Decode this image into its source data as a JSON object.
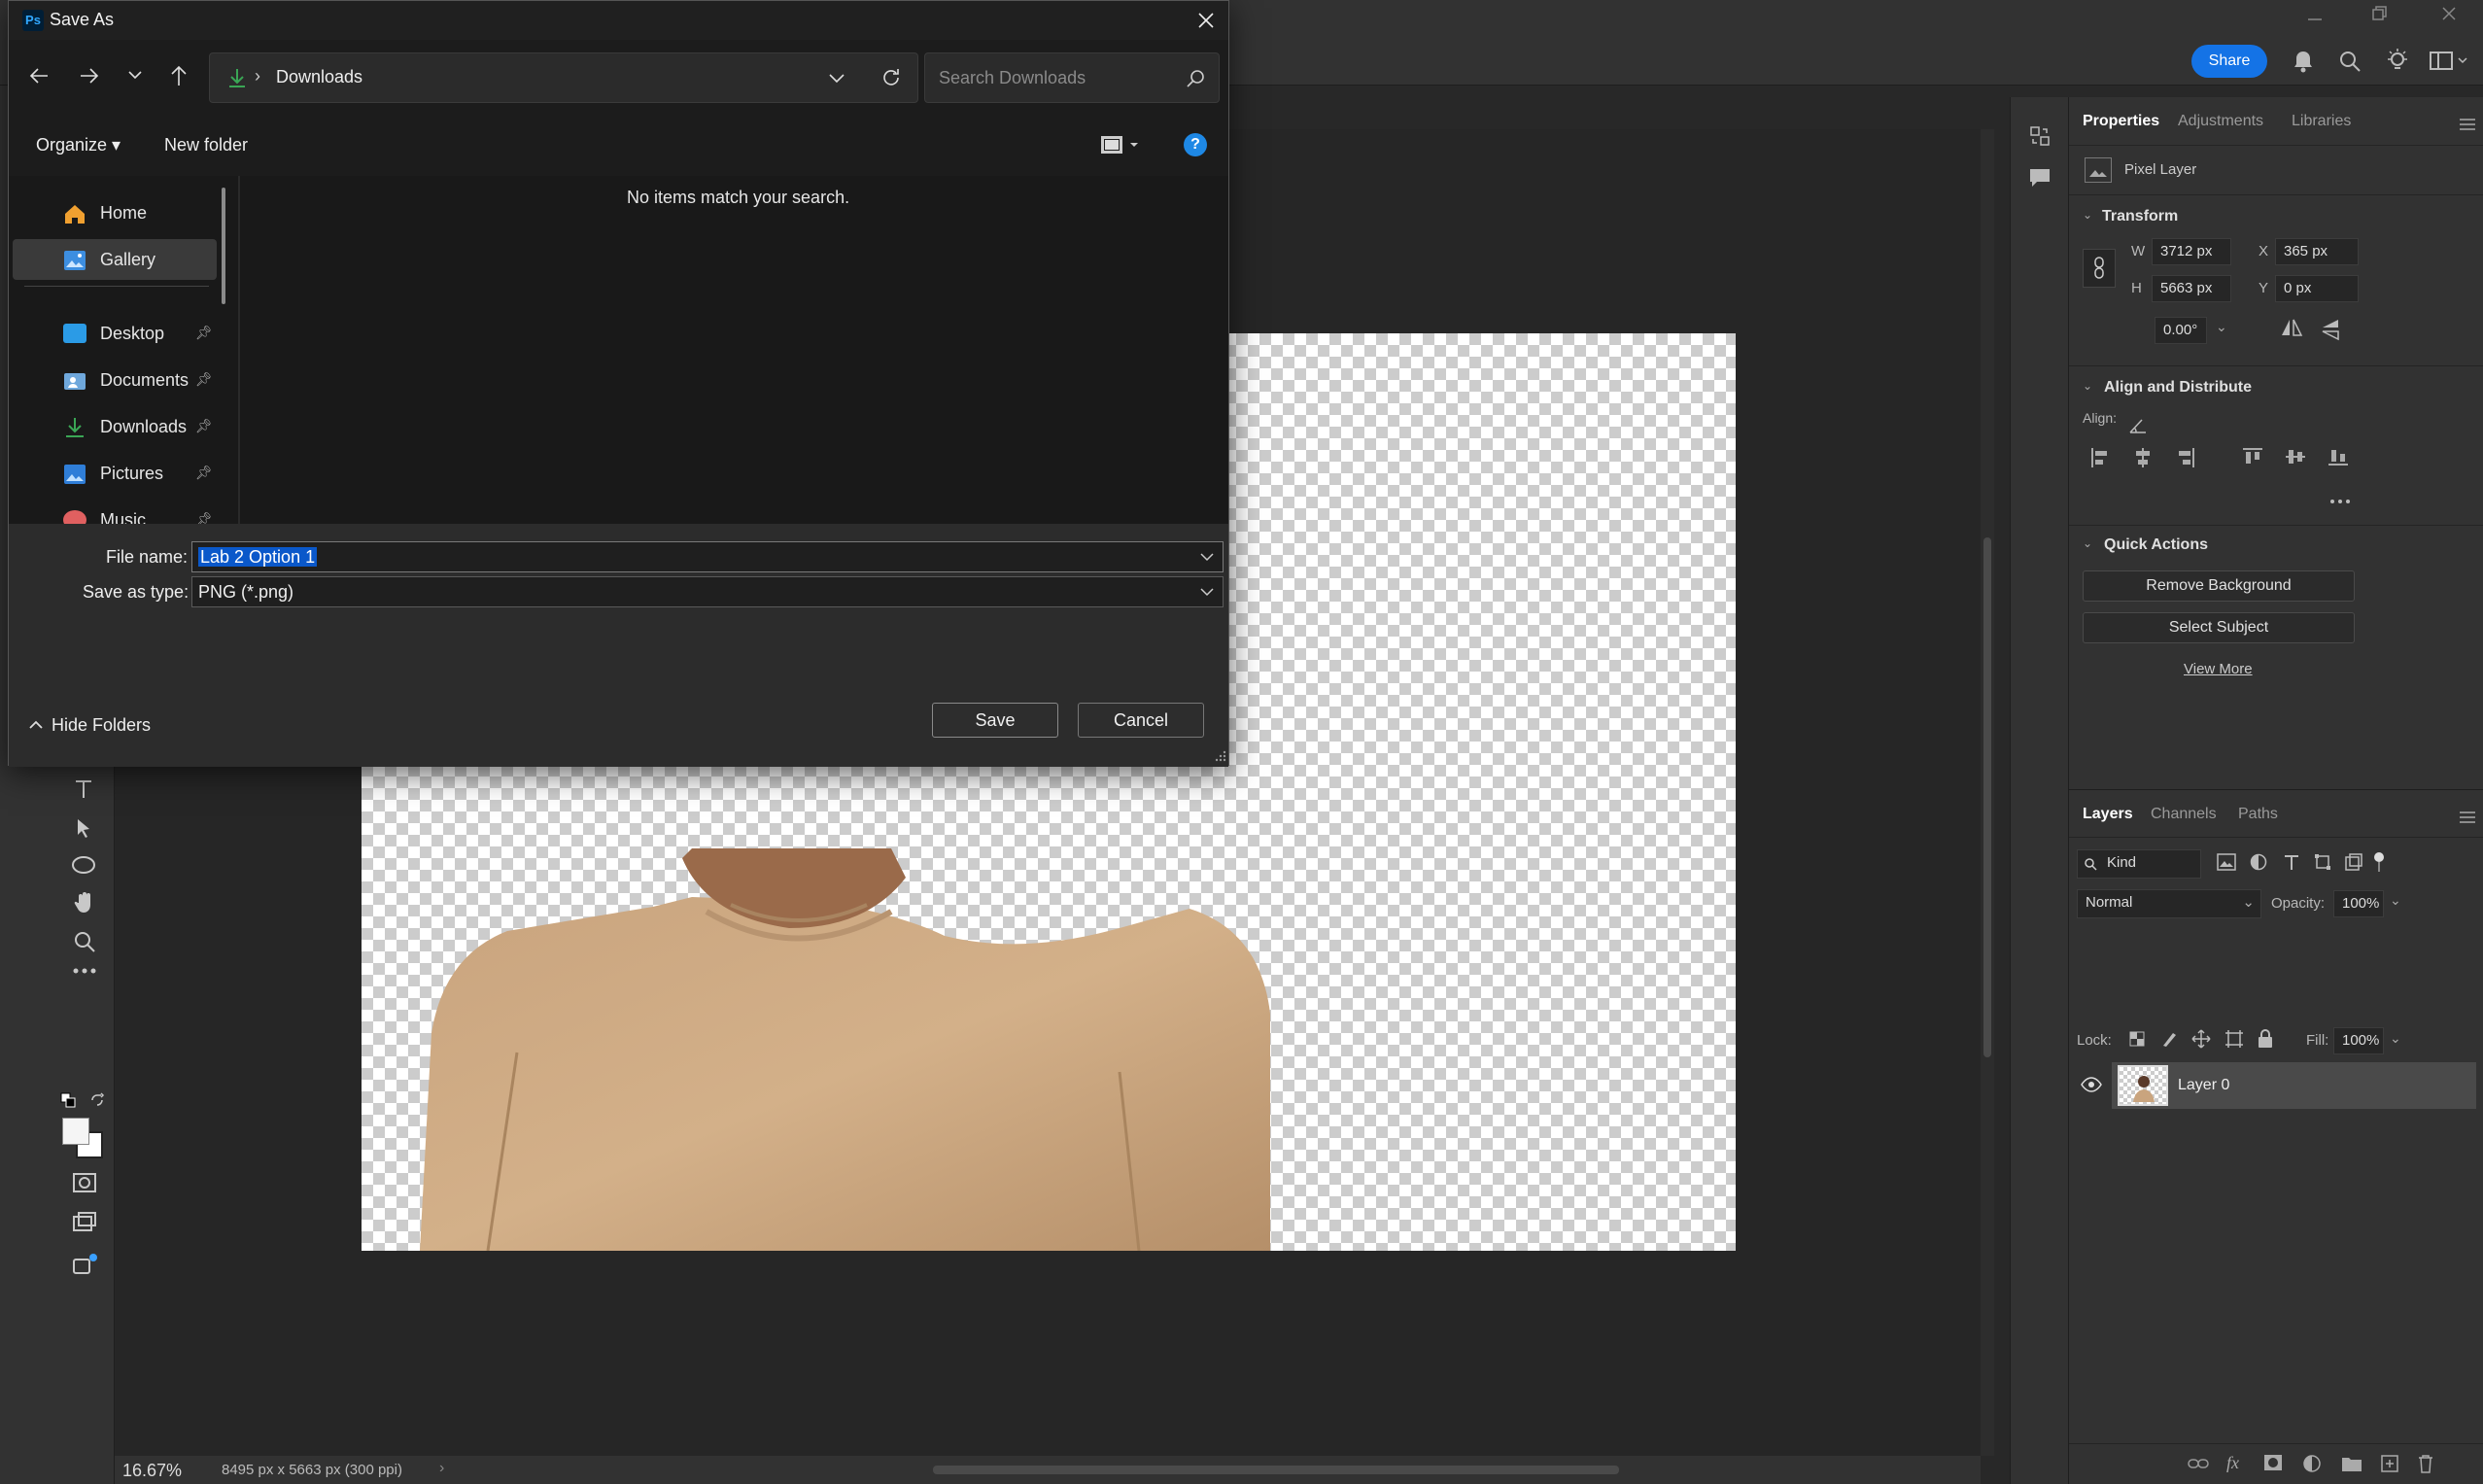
{
  "dialog": {
    "title": "Save As",
    "app_badge": "Ps",
    "breadcrumb": {
      "separator": "›",
      "location": "Downloads"
    },
    "search": {
      "placeholder": "Search Downloads"
    },
    "toolbar": {
      "organize_label": "Organize ▾",
      "new_folder_label": "New folder"
    },
    "empty_message": "No items match your search.",
    "nav_items": [
      {
        "label": "Home",
        "icon": "home-icon",
        "pinned": false
      },
      {
        "label": "Gallery",
        "icon": "gallery-icon",
        "pinned": false
      },
      {
        "label": "Desktop",
        "icon": "desktop-icon",
        "pinned": true
      },
      {
        "label": "Documents",
        "icon": "documents-icon",
        "pinned": true
      },
      {
        "label": "Downloads",
        "icon": "downloads-icon",
        "pinned": true
      },
      {
        "label": "Pictures",
        "icon": "pictures-icon",
        "pinned": true
      },
      {
        "label": "Music",
        "icon": "music-icon",
        "pinned": true
      }
    ],
    "file_name": {
      "label": "File name:",
      "value": "Lab 2 Option 1"
    },
    "save_type": {
      "label": "Save as type:",
      "value": "PNG (*.png)"
    },
    "hide_folders_label": "Hide Folders",
    "save_label": "Save",
    "cancel_label": "Cancel"
  },
  "ps": {
    "share_label": "Share",
    "accent": "#1473e6",
    "status": {
      "zoom": "16.67%",
      "doc_info": "8495 px x 5663 px (300 ppi)"
    },
    "properties": {
      "tabs": [
        "Properties",
        "Adjustments",
        "Libraries"
      ],
      "layer_kind": "Pixel Layer",
      "transform_title": "Transform",
      "w_label": "W",
      "w_value": "3712 px",
      "h_label": "H",
      "h_value": "5663 px",
      "x_label": "X",
      "x_value": "365 px",
      "y_label": "Y",
      "y_value": "0 px",
      "angle_value": "0.00°",
      "align_title": "Align and Distribute",
      "align_label": "Align:",
      "quick_title": "Quick Actions",
      "remove_bg_label": "Remove Background",
      "select_subject_label": "Select Subject",
      "view_more_label": "View More"
    },
    "layers": {
      "tabs": [
        "Layers",
        "Channels",
        "Paths"
      ],
      "kind_label": "Kind",
      "blend_mode": "Normal",
      "opacity_label": "Opacity:",
      "opacity_value": "100%",
      "lock_label": "Lock:",
      "fill_label": "Fill:",
      "fill_value": "100%",
      "layer_name": "Layer 0"
    }
  }
}
